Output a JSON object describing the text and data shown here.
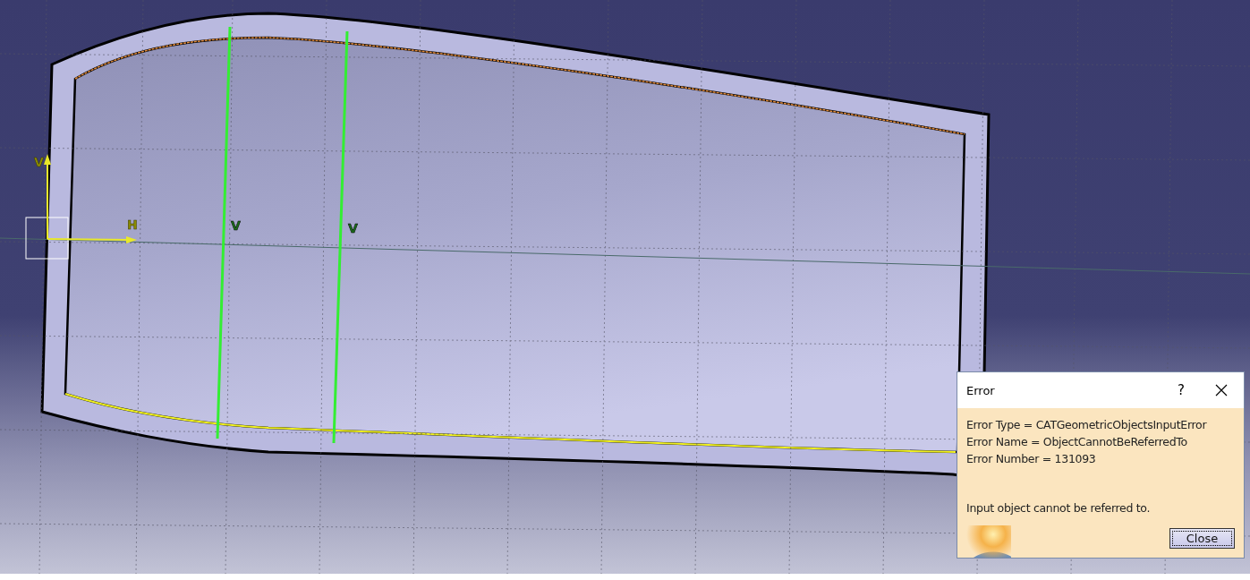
{
  "viewport": {
    "axis_labels": [
      "V",
      "H"
    ],
    "constraint_labels": [
      "V",
      "V"
    ]
  },
  "dialog": {
    "title": "Error",
    "help": "?",
    "details": [
      "Error Type = CATGeometricObjectsInputError",
      "Error Name = ObjectCannotBeReferredTo",
      "Error Number = 131093"
    ],
    "message": "Input object cannot be referred to.",
    "buttons": [
      "Close"
    ]
  }
}
